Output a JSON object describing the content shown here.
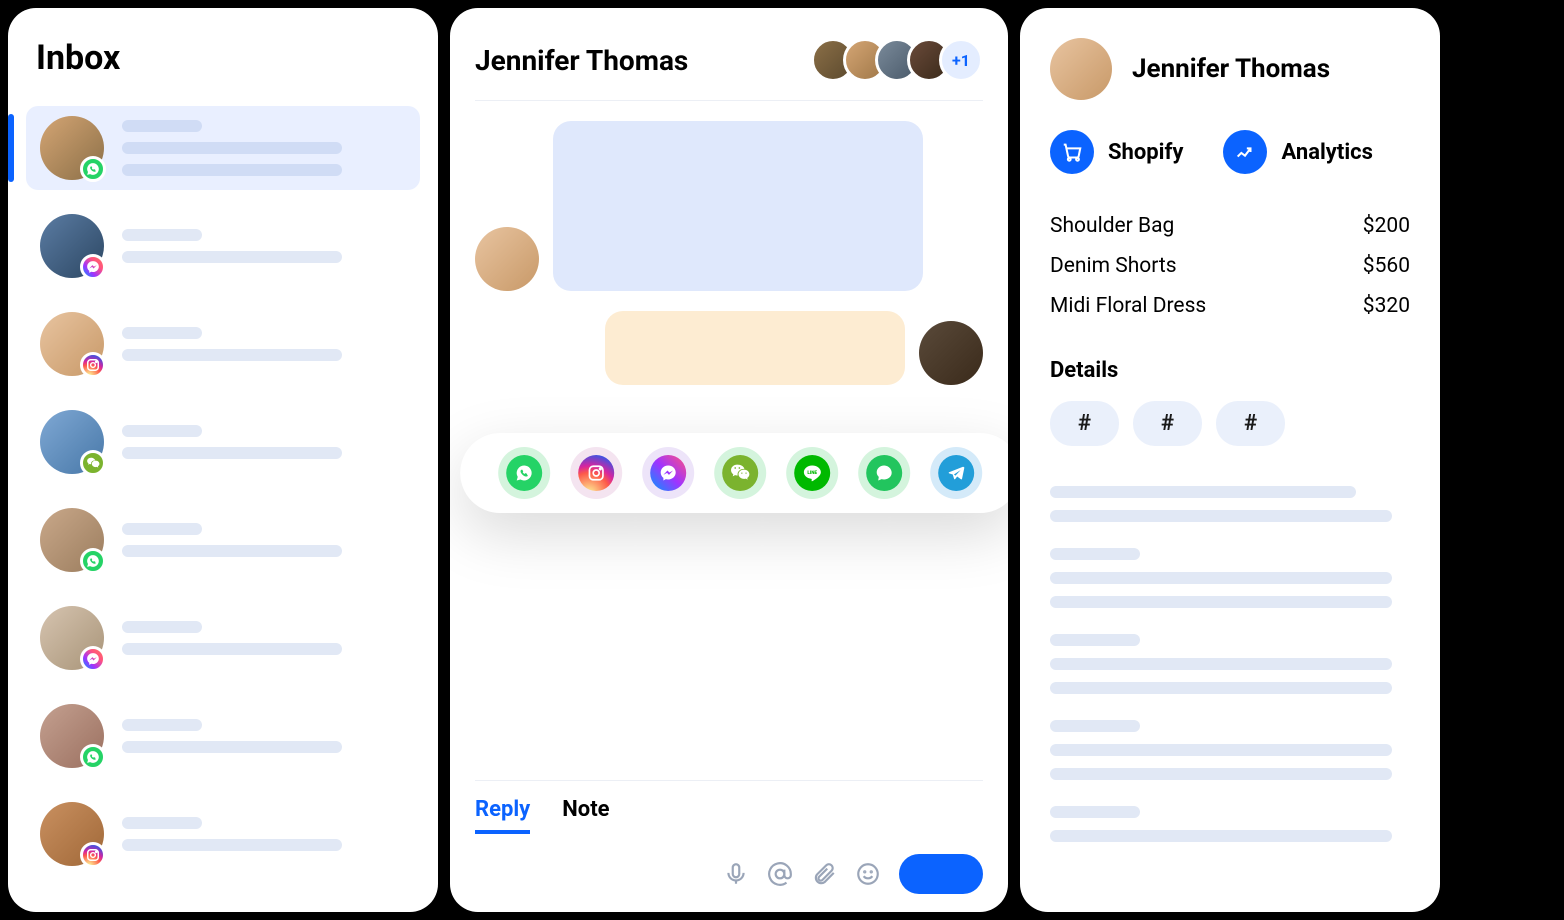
{
  "inbox": {
    "title": "Inbox",
    "items": [
      {
        "channel": "whatsapp",
        "active": true,
        "avatarClass": "a1"
      },
      {
        "channel": "messenger",
        "active": false,
        "avatarClass": "a2"
      },
      {
        "channel": "instagram",
        "active": false,
        "avatarClass": "a3"
      },
      {
        "channel": "wechat",
        "active": false,
        "avatarClass": "a4"
      },
      {
        "channel": "whatsapp",
        "active": false,
        "avatarClass": "a5"
      },
      {
        "channel": "messenger",
        "active": false,
        "avatarClass": "a6"
      },
      {
        "channel": "whatsapp",
        "active": false,
        "avatarClass": "a7"
      },
      {
        "channel": "instagram",
        "active": false,
        "avatarClass": "a8"
      }
    ]
  },
  "chat": {
    "title": "Jennifer Thomas",
    "participants_overflow": "+1",
    "channels": [
      "whatsapp",
      "instagram",
      "messenger",
      "wechat",
      "line",
      "sms",
      "telegram"
    ],
    "tabs": {
      "reply": "Reply",
      "note": "Note"
    }
  },
  "details": {
    "name": "Jennifer Thomas",
    "actions": {
      "shopify": "Shopify",
      "analytics": "Analytics"
    },
    "products": [
      {
        "name": "Shoulder Bag",
        "price": "$200"
      },
      {
        "name": "Denim Shorts",
        "price": "$560"
      },
      {
        "name": "Midi Floral Dress",
        "price": "$320"
      }
    ],
    "section_details": "Details",
    "tags": [
      "#",
      "#",
      "#"
    ]
  }
}
